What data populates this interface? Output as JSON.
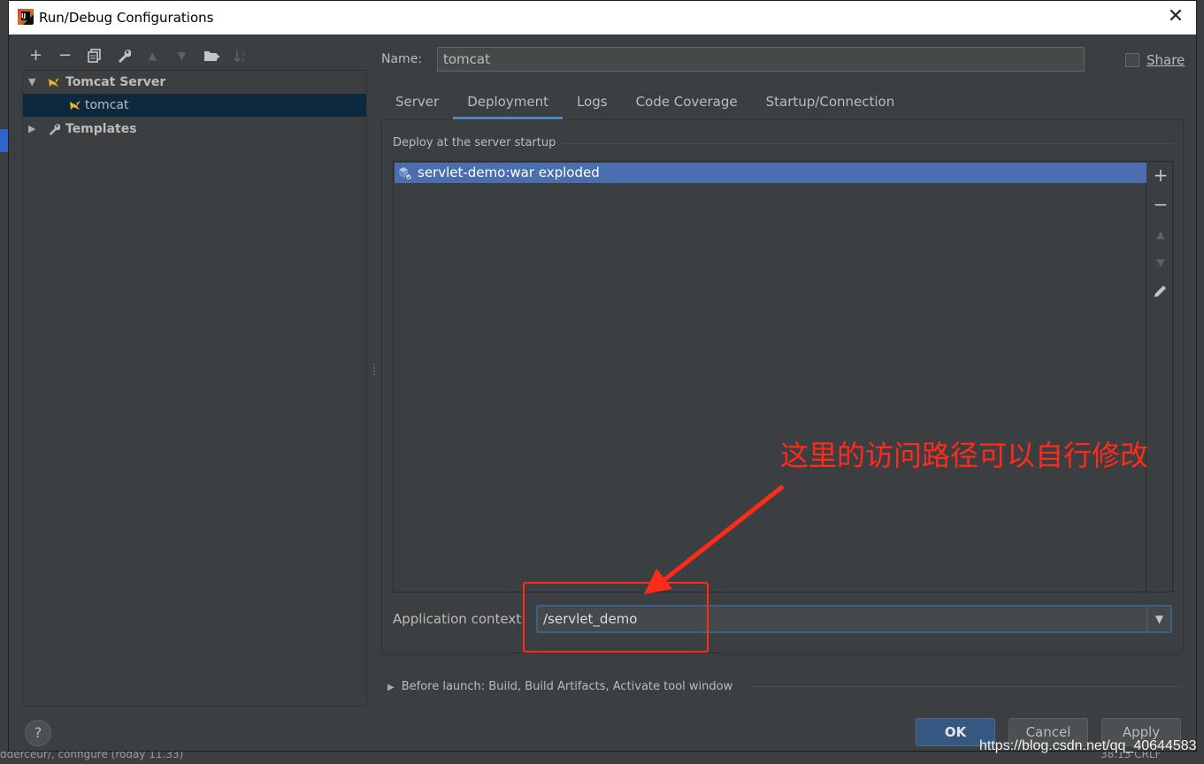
{
  "window": {
    "title": "Run/Debug Configurations",
    "close_glyph": "✕"
  },
  "toolbar": {
    "add": "+",
    "remove": "−",
    "copy_icon": "copy-icon",
    "edit_icon": "wrench-icon",
    "up": "▲",
    "down": "▼",
    "folder_icon": "folder-add-icon",
    "sort_icon": "sort-icon"
  },
  "tree": {
    "items": [
      {
        "label": "Tomcat Server",
        "expanded": true,
        "icon": "tomcat-icon"
      },
      {
        "label": "tomcat",
        "selected": true,
        "icon": "tomcat-icon"
      },
      {
        "label": "Templates",
        "expanded": false,
        "icon": "wrench-icon"
      }
    ],
    "expanded_arrow": "▼",
    "collapsed_arrow": "▶"
  },
  "form": {
    "name_label": "Name:",
    "name_value": "tomcat",
    "share_label": "Share",
    "share_checked": false
  },
  "tabs": [
    {
      "label": "Server",
      "active": false
    },
    {
      "label": "Deployment",
      "active": true
    },
    {
      "label": "Logs",
      "active": false
    },
    {
      "label": "Code Coverage",
      "active": false
    },
    {
      "label": "Startup/Connection",
      "active": false
    }
  ],
  "deployment": {
    "group_title": "Deploy at the server startup",
    "artifacts": [
      "servlet-demo:war exploded"
    ],
    "side_tools": {
      "add": "+",
      "remove": "−",
      "up": "▲",
      "down": "▼",
      "edit_icon": "pencil-icon"
    },
    "context_label": "Application context:",
    "context_value": "/servlet_demo",
    "dropdown_glyph": "▼"
  },
  "before_launch": {
    "arrow": "▶",
    "text": "Before launch: Build, Build Artifacts, Activate tool window"
  },
  "buttons": {
    "help": "?",
    "ok": "OK",
    "cancel": "Cancel",
    "apply": "Apply"
  },
  "annotation": {
    "text": "这里的访问路径可以自行修改",
    "color": "#ff2a1a"
  },
  "watermark": "https://blog.csdn.net/qq_40644583",
  "background_fragments": {
    "bottom_left": "dderceur/, configure (roday 11.33)",
    "bottom_right": "38.13   CRLF"
  },
  "colors": {
    "selection": "#4b6eaf",
    "tree_selection": "#0d293e",
    "primary_button": "#365880",
    "accent_tab": "#4a88c7"
  }
}
